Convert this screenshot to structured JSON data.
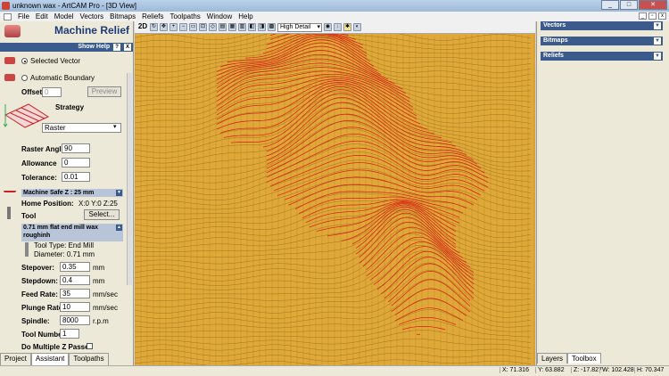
{
  "window": {
    "title": "unknown wax - ArtCAM Pro - [3D View]",
    "controls": [
      "_",
      "□",
      "✕"
    ]
  },
  "menu": [
    "File",
    "Edit",
    "Model",
    "Vectors",
    "Bitmaps",
    "Reliefs",
    "Toolpaths",
    "Window",
    "Help"
  ],
  "left_panel": {
    "title": "Machine Relief",
    "show_help": "Show Help",
    "help_buttons": [
      "?",
      "X"
    ],
    "area_options": [
      {
        "label": "Selected Vector",
        "selected": true
      },
      {
        "label": "Automatic Boundary",
        "selected": false
      }
    ],
    "offset_label": "Offset",
    "offset_value": "0",
    "preview_label": "Preview",
    "strategy_label": "Strategy",
    "strategy_value": "Raster",
    "raster_angle_label": "Raster Angle:",
    "raster_angle_value": "90",
    "allowance_label": "Allowance",
    "allowance_value": "0",
    "tolerance_label": "Tolerance:",
    "tolerance_value": "0.01",
    "machine_safe_label": "Machine Safe Z : 25 mm",
    "home_position_label": "Home Position:",
    "home_position_value": "X:0 Y:0 Z:25",
    "tool_label": "Tool",
    "tool_select_label": "Select...",
    "tool_name": "0.71 mm flat end mill wax roughinh",
    "tool_type": "Tool Type: End Mill",
    "tool_diameter": "Diameter: 0.71 mm",
    "stepover_label": "Stepover:",
    "stepover_value": "0.35",
    "stepover_unit": "mm",
    "stepdown_label": "Stepdown:",
    "stepdown_value": "0.4",
    "stepdown_unit": "mm",
    "feed_rate_label": "Feed Rate:",
    "feed_rate_value": "35",
    "feed_rate_unit": "mm/sec",
    "plunge_rate_label": "Plunge Rate:",
    "plunge_rate_value": "10",
    "plunge_rate_unit": "mm/sec",
    "spindle_label": "Spindle:",
    "spindle_value": "8000",
    "spindle_unit": "r.p.m",
    "tool_number_label": "Tool Number:",
    "tool_number_value": "1",
    "multiple_z_label": "Do Multiple Z Passes",
    "tabs": [
      "Project",
      "Assistant",
      "Toolpaths"
    ],
    "active_tab": "Assistant"
  },
  "viewport": {
    "mode_label": "2D",
    "detail_select": "High Detail"
  },
  "right_panel": {
    "sections": [
      "Vectors",
      "Bitmaps",
      "Reliefs"
    ],
    "tabs": [
      "Layers",
      "Toolbox"
    ],
    "active_tab": "Toolbox"
  },
  "status": {
    "x": "X: 71.316",
    "y": "Y: 63.882",
    "z": "Z: -17.827",
    "w": "W: 102.428",
    "h": "H: 70.347"
  },
  "colors": {
    "relief_fill": "#e0a838",
    "mesh_line": "#6b5210",
    "toolpath": "#e01818",
    "panel_bar": "#3b5b8c"
  }
}
